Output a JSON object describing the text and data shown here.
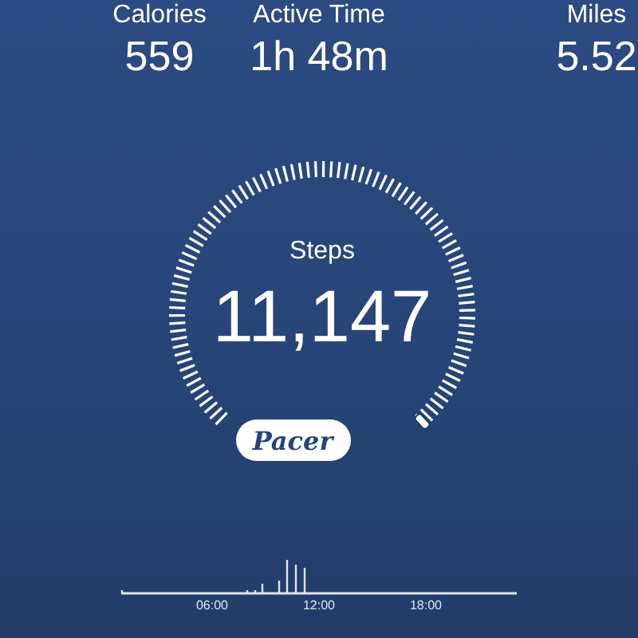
{
  "stats": [
    {
      "label": "Calories",
      "value": "559"
    },
    {
      "label": "Active Time",
      "value": "1h 48m"
    },
    {
      "label": "Miles",
      "value": "5.52"
    }
  ],
  "steps": {
    "label": "Steps",
    "value": "11,147"
  },
  "logo": "Pacer",
  "activity": {
    "time_labels": [
      "06:00",
      "12:00",
      "18:00"
    ]
  }
}
